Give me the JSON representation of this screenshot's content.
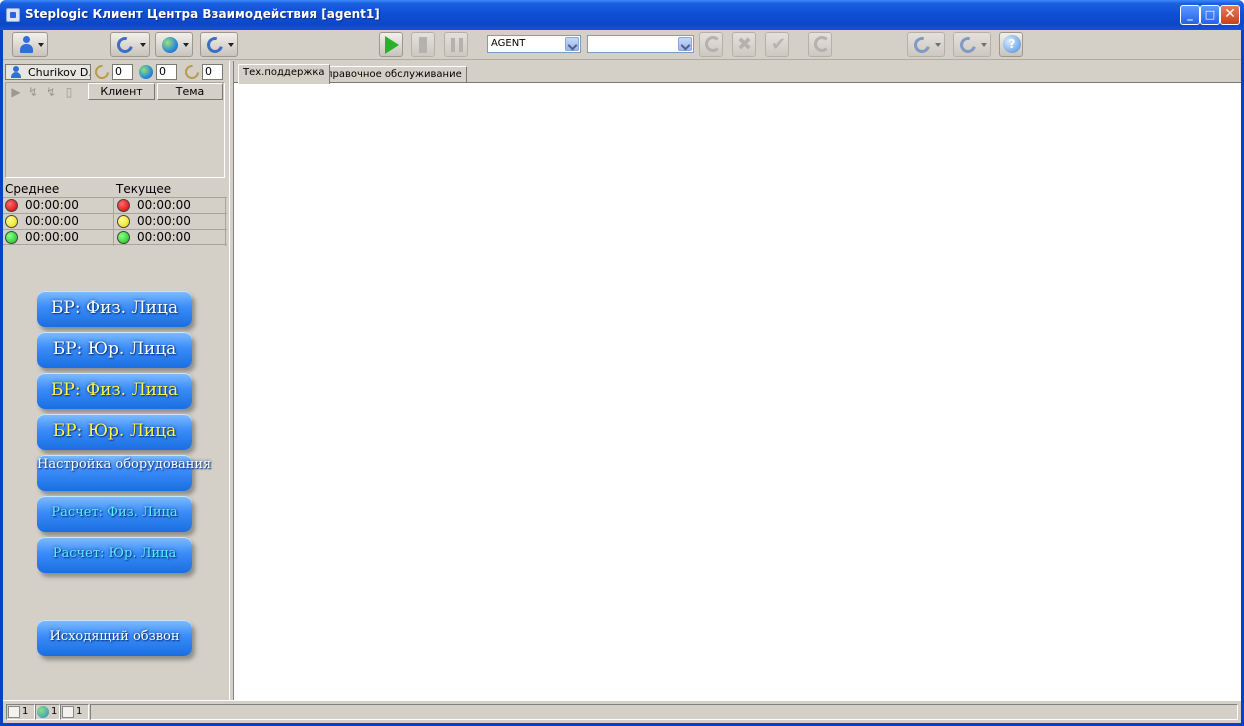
{
  "window": {
    "title": "Steplogic Клиент Центра Взаимодействия [agent1]",
    "minimize_label": "_",
    "maximize_label": "□",
    "close_label": "✕"
  },
  "toolbar": {
    "agent_combo_value": "AGENT",
    "second_combo_value": "",
    "icons": [
      "person-menu-icon",
      "phone-menu-icon",
      "globe-menu-icon",
      "phone-globe-menu-icon",
      "play-icon",
      "down-icon",
      "pause-icon",
      "refresh-icon",
      "close-icon",
      "check-icon",
      "transfer-icon",
      "conference-icon",
      "hold-icon",
      "help-icon"
    ],
    "help_glyph": "?",
    "x_glyph": "✖",
    "check_glyph": "✔"
  },
  "agent": {
    "name": "Churikov D.",
    "phone_count": "0",
    "globe_count": "0",
    "task_count": "0"
  },
  "queue": {
    "columns": [
      "Клиент",
      "Тема"
    ],
    "icons": [
      "▶",
      "↯",
      "↯",
      "▯"
    ]
  },
  "stats": {
    "headers": [
      "Среднее",
      "Текущее"
    ],
    "rows": [
      {
        "color": "red",
        "avg": "00:00:00",
        "cur": "00:00:00"
      },
      {
        "color": "yellow",
        "avg": "00:00:00",
        "cur": "00:00:00"
      },
      {
        "color": "green",
        "avg": "00:00:00",
        "cur": "00:00:00"
      }
    ]
  },
  "macros": [
    {
      "label": "БР: Физ. Лица",
      "style": "white"
    },
    {
      "label": "БР: Юр. Лица",
      "style": "white"
    },
    {
      "label": "БР: Физ. Лица",
      "style": "yellow"
    },
    {
      "label": "БР: Юр. Лица",
      "style": "yellow"
    },
    {
      "label": "Настройка оборудования",
      "style": "two"
    },
    {
      "label": "Расчет: Физ. Лица",
      "style": "cyan"
    },
    {
      "label": "Расчет: Юр. Лица",
      "style": "cyan"
    },
    {
      "label": "Исходящий обзвон",
      "style": "white-sm"
    }
  ],
  "tabs": [
    {
      "label": "Тех.поддержка",
      "active": true
    },
    {
      "label": "Справочное обслуживание",
      "active": false
    }
  ],
  "statusbar": {
    "items": [
      {
        "icon": "phone-icon",
        "count": "1"
      },
      {
        "icon": "globe-icon",
        "count": "1"
      },
      {
        "icon": "task-icon",
        "count": "1"
      }
    ]
  }
}
